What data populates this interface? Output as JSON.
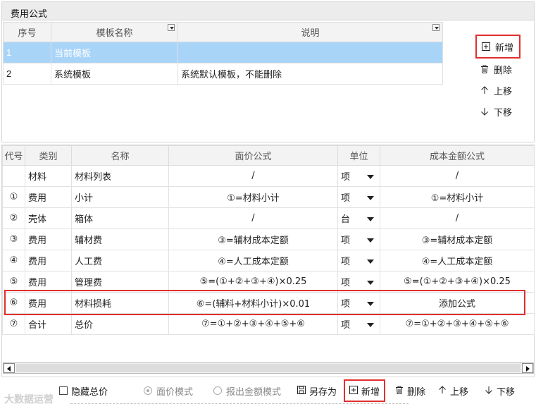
{
  "top_panel": {
    "title": "费用公式",
    "columns": [
      "序号",
      "模板名称",
      "说明"
    ],
    "rows": [
      {
        "no": "1",
        "name": "当前模板",
        "desc": ""
      },
      {
        "no": "2",
        "name": "系统模板",
        "desc": "系统默认模板，不能删除"
      }
    ],
    "actions": {
      "new": "新增",
      "delete": "删除",
      "up": "上移",
      "down": "下移"
    }
  },
  "bottom_panel": {
    "columns": [
      "代号",
      "类别",
      "名称",
      "面价公式",
      "单位",
      "成本金额公式"
    ],
    "rows": [
      {
        "code": "",
        "cat": "材料",
        "name": "材料列表",
        "price": "/",
        "unit": "项",
        "cost": "/"
      },
      {
        "code": "①",
        "cat": "费用",
        "name": "小计",
        "price": "①=材料小计",
        "unit": "项",
        "cost": "①=材料小计"
      },
      {
        "code": "②",
        "cat": "壳体",
        "name": "箱体",
        "price": "/",
        "unit": "台",
        "cost": "/"
      },
      {
        "code": "③",
        "cat": "费用",
        "name": "辅材费",
        "price": "③=辅材成本定额",
        "unit": "项",
        "cost": "③=辅材成本定额"
      },
      {
        "code": "④",
        "cat": "费用",
        "name": "人工费",
        "price": "④=人工成本定额",
        "unit": "项",
        "cost": "④=人工成本定额"
      },
      {
        "code": "⑤",
        "cat": "费用",
        "name": "管理费",
        "price": "⑤=(①+②+③+④)×0.25",
        "unit": "项",
        "cost": "⑤=(①+②+③+④)×0.25"
      },
      {
        "code": "⑥",
        "cat": "费用",
        "name": "材料损耗",
        "price": "⑥=(辅料+材料小计)×0.01",
        "unit": "项",
        "cost": "添加公式"
      },
      {
        "code": "⑦",
        "cat": "合计",
        "name": "总价",
        "price": "⑦=①+②+③+④+⑤+⑥",
        "unit": "项",
        "cost": "⑦=①+②+③+④+⑤+⑥"
      }
    ]
  },
  "bottom_bar": {
    "hide_total": "隐藏总价",
    "price_mode": "面价模式",
    "report_mode": "报出金额模式",
    "save_as": "另存为",
    "new": "新增",
    "delete": "删除",
    "up": "上移",
    "down": "下移"
  },
  "watermark": "大数据运营",
  "colors": {
    "selected_row": "#a8d4f8",
    "highlight_border": "#e0302e"
  }
}
